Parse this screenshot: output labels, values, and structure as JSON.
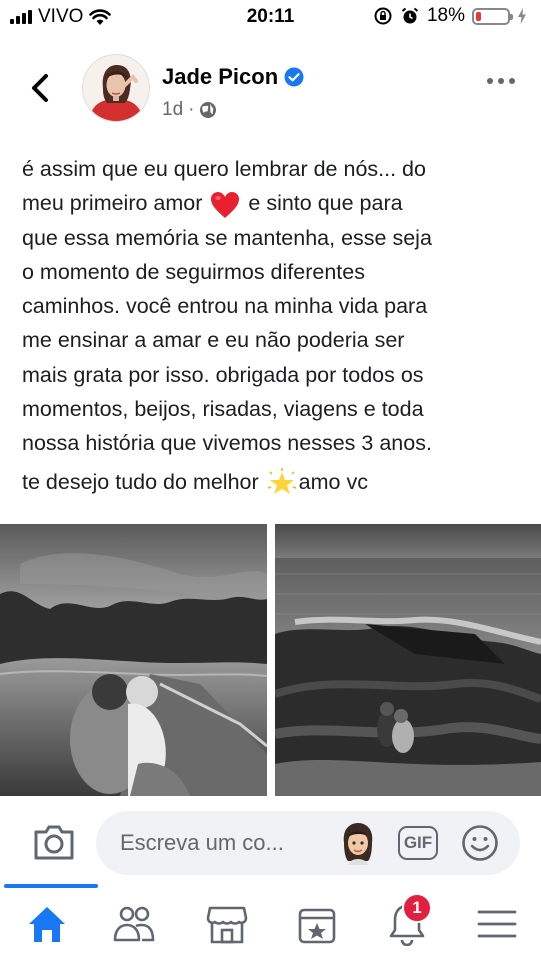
{
  "status_bar": {
    "carrier": "VIVO",
    "time": "20:11",
    "battery_percent": "18%",
    "battery_level": 0.18,
    "battery_color": "#e53935",
    "icons": [
      "signal-bars-icon",
      "wifi-icon",
      "screen-lock-rotation-icon",
      "alarm-icon",
      "battery-icon",
      "charging-bolt-icon"
    ]
  },
  "header": {
    "author_name": "Jade Picon",
    "verified": true,
    "timestamp": "1d",
    "separator": "·",
    "privacy_icon": "globe-icon",
    "back_icon": "back-chevron-icon",
    "more_icon": "more-dots-icon"
  },
  "post": {
    "lines": [
      "é assim que eu quero lembrar de nós... do",
      "meu primeiro amor",
      "e sinto que para",
      "que essa memória se mantenha, esse seja",
      "o momento de seguirmos diferentes",
      "caminhos. você entrou na minha vida para",
      "me ensinar a amar e eu não poderia ser",
      "mais grata por isso. obrigada por todos os",
      "momentos, beijos, risadas, viagens e toda",
      "nossa história que vivemos nesses 3 anos.",
      "te desejo tudo do melhor",
      "amo vc"
    ],
    "emojis": [
      "red-heart-emoji",
      "glowing-star-emoji"
    ]
  },
  "photos": [
    {
      "name": "couple-on-boat-photo",
      "style": "black-and-white"
    },
    {
      "name": "couple-on-rocks-by-sea-photo",
      "style": "black-and-white"
    }
  ],
  "comment_bar": {
    "placeholder": "Escreva um co...",
    "camera_icon": "camera-icon",
    "avatar_sticker_icon": "avatar-sticker-icon",
    "gif_label": "GIF",
    "emoji_icon": "smiley-icon"
  },
  "tab_bar": {
    "tabs": [
      "home-icon",
      "friends-icon",
      "marketplace-icon",
      "pages-icon",
      "notifications-icon",
      "menu-icon"
    ],
    "active_tab": "home-icon",
    "notification_badge": "1",
    "accent_color": "#1877f2",
    "badge_color": "#e41e3f"
  }
}
